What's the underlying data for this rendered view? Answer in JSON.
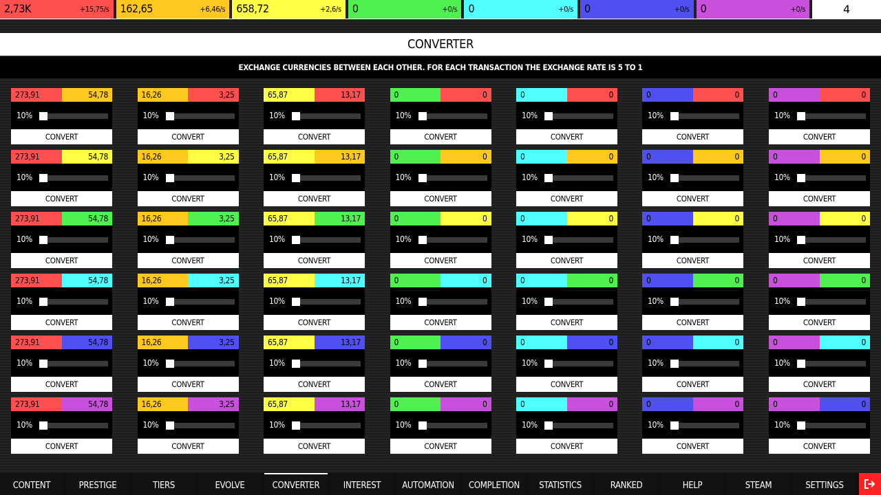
{
  "currencies": [
    {
      "amount": "2,73K",
      "rate": "+15,75/s",
      "color": "#ff5050"
    },
    {
      "amount": "162,65",
      "rate": "+6,46/s",
      "color": "#ffc81e"
    },
    {
      "amount": "658,72",
      "rate": "+2,6/s",
      "color": "#ffff46"
    },
    {
      "amount": "0",
      "rate": "+0/s",
      "color": "#50f050"
    },
    {
      "amount": "0",
      "rate": "+0/s",
      "color": "#50ffff"
    },
    {
      "amount": "0",
      "rate": "+0/s",
      "color": "#5050f0"
    },
    {
      "amount": "0",
      "rate": "+0/s",
      "color": "#c850dc"
    }
  ],
  "level": "4",
  "header": {
    "title": "CONVERTER",
    "subtitle": "EXCHANGE CURRENCIES BETWEEN EACH OTHER. FOR EACH TRANSACTION THE EXCHANGE RATE IS 5 TO 1"
  },
  "converter": {
    "percent_label": "10%",
    "slider_value": 0.1,
    "button_label": "CONVERT",
    "columns": [
      {
        "from": "273,91",
        "to": "54,78",
        "color": "#ff5050"
      },
      {
        "from": "16,26",
        "to": "3,25",
        "color": "#ffc81e"
      },
      {
        "from": "65,87",
        "to": "13,17",
        "color": "#ffff46"
      },
      {
        "from": "0",
        "to": "0",
        "color": "#50f050"
      },
      {
        "from": "0",
        "to": "0",
        "color": "#50ffff"
      },
      {
        "from": "0",
        "to": "0",
        "color": "#5050f0"
      },
      {
        "from": "0",
        "to": "0",
        "color": "#c850dc"
      }
    ]
  },
  "nav": {
    "tabs": [
      "CONTENT",
      "PRESTIGE",
      "TIERS",
      "EVOLVE",
      "CONVERTER",
      "INTEREST",
      "AUTOMATION",
      "COMPLETION",
      "STATISTICS",
      "RANKED",
      "HELP",
      "STEAM",
      "SETTINGS"
    ],
    "active": "CONVERTER"
  }
}
